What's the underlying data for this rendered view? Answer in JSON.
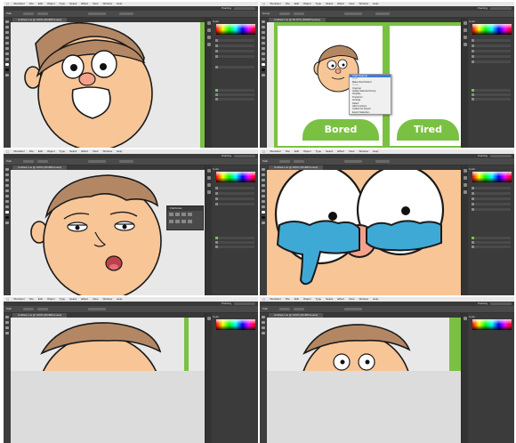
{
  "app": {
    "name": "Illustrator",
    "menu_items": [
      "Illustrator",
      "File",
      "Edit",
      "Object",
      "Type",
      "Select",
      "Effect",
      "View",
      "Window",
      "Help"
    ],
    "workspace_label": "Painting"
  },
  "panels": {
    "label": "Color"
  },
  "frames": [
    {
      "doc_tab": "Untitled-1.ai @ 100% (RGB/Preview)",
      "ctrl_label": "Path"
    },
    {
      "doc_tab": "Untitled-1.ai @ 66.67% (RGB/Preview)",
      "ctrl_label": "Group",
      "labels": [
        "Bored",
        "Tired"
      ],
      "context_menu": [
        "Undo Ungroup",
        "Redo",
        "",
        "Make Pixel Perfect",
        "",
        "Group",
        "Ungroup",
        "Isolate Selected Group",
        "Simplify...",
        "",
        "Transform",
        "Arrange",
        "Select",
        "Add to Library",
        "Collect For Export",
        "Export Selection..."
      ]
    },
    {
      "doc_tab": "Untitled-1.ai @ 100% (RGB/Preview)",
      "ctrl_label": "Path",
      "float_panel": "Pathfinder"
    },
    {
      "doc_tab": "Untitled-1.ai @ 400% (RGB/Preview)",
      "ctrl_label": "Path"
    },
    {
      "doc_tab": "Untitled-1.ai @ 100% (RGB/Preview)",
      "ctrl_label": "Path"
    },
    {
      "doc_tab": "Untitled-1.ai @ 100% (RGB/Preview)",
      "ctrl_label": "Path"
    }
  ],
  "colors": {
    "skin": "#f8c597",
    "hair": "#b48764",
    "green": "#7ac143",
    "tear": "#3fa9d6",
    "nose": "#f4a28c",
    "ui_dark": "#535353"
  }
}
